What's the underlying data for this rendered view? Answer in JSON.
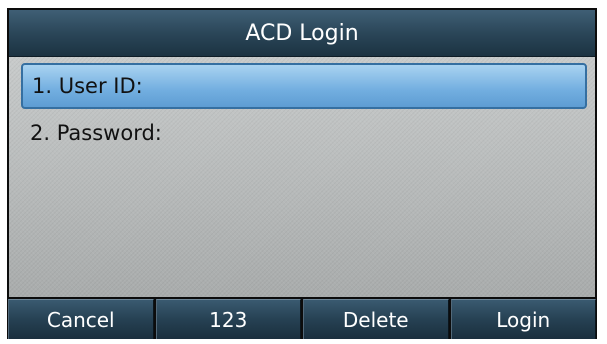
{
  "title": "ACD Login",
  "menu": {
    "items": [
      {
        "label": "1. User ID:",
        "selected": true
      },
      {
        "label": "2. Password:",
        "selected": false
      }
    ]
  },
  "softkeys": [
    "Cancel",
    "123",
    "Delete",
    "Login"
  ],
  "colors": {
    "title_bar": "#294456",
    "selection": "#72aee0",
    "softkey": "#264153",
    "background": "#b4b7b7"
  }
}
